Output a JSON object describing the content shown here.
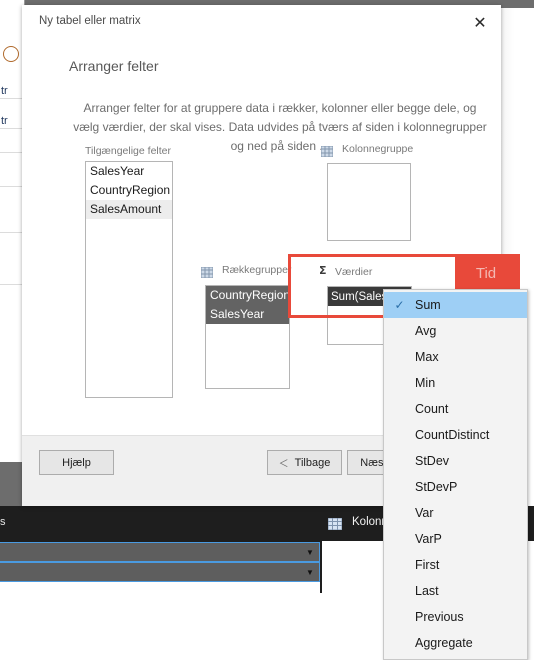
{
  "background": {
    "left_window_rows": [
      "tr",
      "tr"
    ],
    "icon": "circle-icon"
  },
  "bottom_panel": {
    "partial_label": "s",
    "grid_icon": "grid-icon",
    "kolonne_label": "Kolonne",
    "dropdown_arrow": "▼",
    "rows": 2
  },
  "dialog": {
    "title": "Ny tabel eller matrix",
    "close_icon": "✕",
    "heading": "Arranger felter",
    "description": "Arranger felter for at gruppere data i rækker, kolonner eller begge dele, og vælg værdier, der skal vises. Data udvides på tværs af siden i kolonnegrupper og ned på siden ...",
    "available_fields": {
      "label": "Tilgængelige felter",
      "items": [
        {
          "label": "SalesYear",
          "state": "normal"
        },
        {
          "label": "CountryRegion",
          "state": "normal"
        },
        {
          "label": "SalesAmount",
          "state": "hover"
        }
      ]
    },
    "column_group": {
      "label": "Kolonnegruppe",
      "icon": "grid-icon",
      "items": []
    },
    "row_groups": {
      "label": "Rækkegrupper",
      "icon": "grid-icon",
      "items": [
        {
          "label": "CountryRegion",
          "state": "selected"
        },
        {
          "label": "SalesYear",
          "state": "selected"
        }
      ]
    },
    "values": {
      "label": "Værdier",
      "icon": "sigma-icon",
      "combo_value": "Sum(Sales...",
      "combo_arrow": "▼"
    },
    "footer": {
      "help_label": "Hjælp",
      "back_label": "Tilbage",
      "back_chevron": "＜",
      "next_label": "Næste",
      "next_chevron": "＞"
    }
  },
  "annotation": {
    "tag_label": "Tid",
    "color": "#e8493a"
  },
  "aggregate_menu": {
    "check_glyph": "✓",
    "items": [
      {
        "label": "Sum",
        "checked": true
      },
      {
        "label": "Avg",
        "checked": false
      },
      {
        "label": "Max",
        "checked": false
      },
      {
        "label": "Min",
        "checked": false
      },
      {
        "label": "Count",
        "checked": false
      },
      {
        "label": "CountDistinct",
        "checked": false
      },
      {
        "label": "StDev",
        "checked": false
      },
      {
        "label": "StDevP",
        "checked": false
      },
      {
        "label": "Var",
        "checked": false
      },
      {
        "label": "VarP",
        "checked": false
      },
      {
        "label": "First",
        "checked": false
      },
      {
        "label": "Last",
        "checked": false
      },
      {
        "label": "Previous",
        "checked": false
      },
      {
        "label": "Aggregate",
        "checked": false
      }
    ]
  }
}
